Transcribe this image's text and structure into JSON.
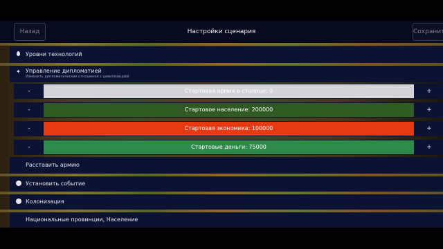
{
  "header": {
    "back_label": "Назад",
    "title": "Настройки сценария",
    "save_label": "Сохранить"
  },
  "menu": {
    "tech_levels": {
      "label": "Уровни технологий",
      "icon": "pin-icon"
    },
    "diplomacy": {
      "label": "Управление дипломатией",
      "sublabel": "Изменить дипломатические отношения с цивилизацией",
      "icon": "dove-icon"
    },
    "deploy_army": {
      "label": "Расставить армию"
    },
    "set_event": {
      "label": "Установить событие",
      "icon": "circle-icon"
    },
    "colonization": {
      "label": "Колонизация",
      "icon": "circle-icon"
    },
    "provinces": {
      "label": "Национальные провинции, Население"
    }
  },
  "stats": [
    {
      "label": "Стартовая армия в столице: 0",
      "color": "#d4d4d8",
      "minus": "-",
      "plus": "+"
    },
    {
      "label": "Стартовое население: 200000",
      "color": "#2f5a22",
      "minus": "-",
      "plus": "+"
    },
    {
      "label": "Стартовая экономика: 100000",
      "color": "#e63a12",
      "minus": "-",
      "plus": "+"
    },
    {
      "label": "Стартовые деньги: 75000",
      "color": "#2e8a4a",
      "minus": "-",
      "plus": "+"
    }
  ]
}
